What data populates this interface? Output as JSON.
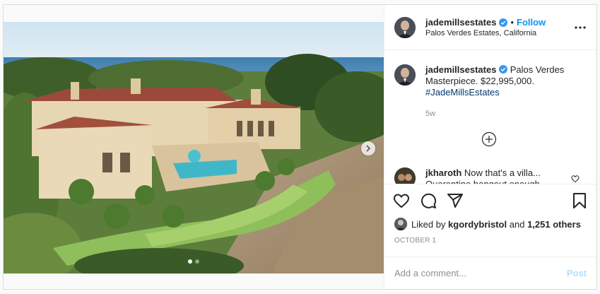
{
  "post": {
    "author": {
      "username": "jademillsestates",
      "verified": true,
      "follow_label": "Follow",
      "separator": "•",
      "location": "Palos Verdes Estates, California"
    },
    "more_icon": "more-horizontal-icon",
    "caption": {
      "username": "jademillsestates",
      "text": "Palos Verdes Masterpiece. $22,995,000.",
      "hashtag": "#JadeMillsEstates",
      "time": "5w"
    },
    "load_more_icon": "plus-circle-icon",
    "comments": [
      {
        "username": "jkharoth",
        "line1": "Now that's a villa...",
        "line2": "Quarantine hangout enough"
      }
    ],
    "actions": {
      "like_icon": "heart-icon",
      "comment_icon": "comment-icon",
      "share_icon": "send-icon",
      "save_icon": "bookmark-icon"
    },
    "likes": {
      "prefix": "Liked by",
      "user": "kgordybristol",
      "conjunction": "and",
      "count": "1,251 others"
    },
    "date": "OCTOBER 1",
    "add_comment": {
      "placeholder": "Add a comment...",
      "post_label": "Post"
    },
    "carousel": {
      "current": 1,
      "total": 2
    },
    "colors": {
      "accent": "#0095f6",
      "post_disabled": "#b2dffc",
      "hashtag": "#00376b",
      "muted": "#8e8e8e"
    }
  }
}
